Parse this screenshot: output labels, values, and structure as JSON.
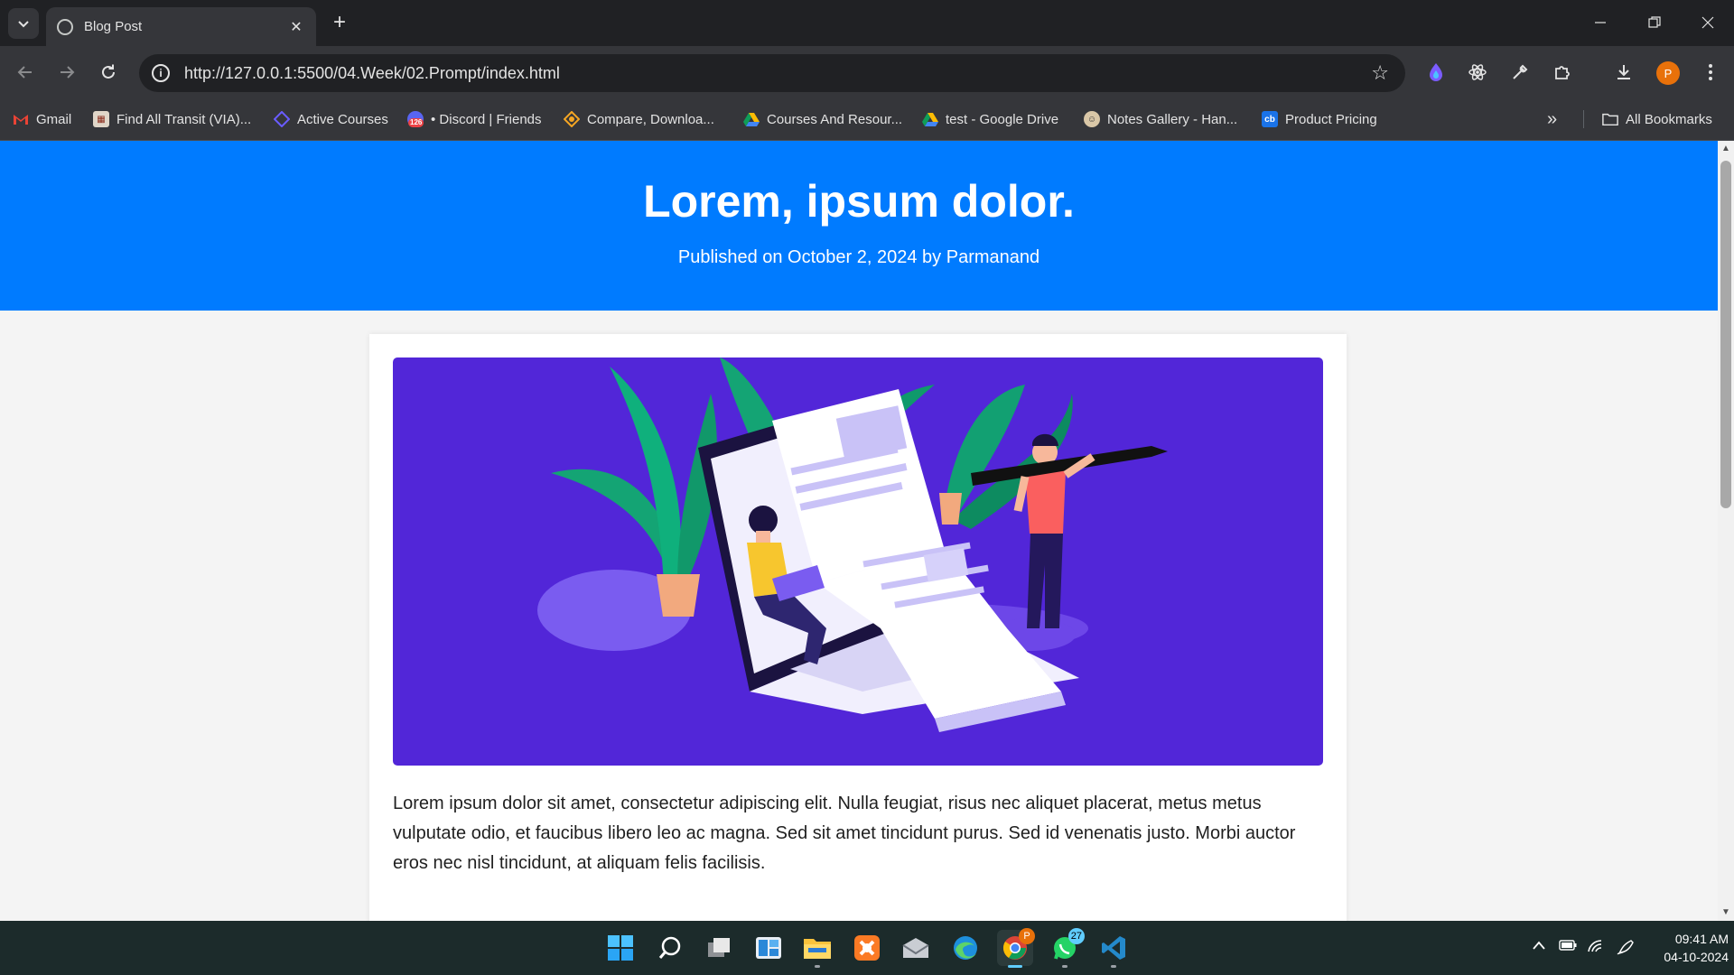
{
  "browser": {
    "tab_title": "Blog Post",
    "new_tab": "+",
    "close_tab": "✕",
    "url": "http://127.0.0.1:5500/04.Week/02.Prompt/index.html",
    "profile_initial": "P"
  },
  "bookmarks": {
    "items": [
      {
        "label": "Gmail",
        "icon": "gmail-icon"
      },
      {
        "label": "Find All Transit (VIA)...",
        "icon": "transit-icon"
      },
      {
        "label": "Active Courses",
        "icon": "courses-icon"
      },
      {
        "label": "• Discord | Friends",
        "icon": "discord-icon",
        "badge": "126"
      },
      {
        "label": "Compare, Downloa...",
        "icon": "compare-icon"
      },
      {
        "label": "Courses And Resour...",
        "icon": "google-drive-icon"
      },
      {
        "label": "test - Google Drive",
        "icon": "google-drive-icon"
      },
      {
        "label": "Notes Gallery - Han...",
        "icon": "notes-icon"
      },
      {
        "label": "Product Pricing",
        "icon": "pricing-icon",
        "badge": "cb"
      }
    ],
    "overflow": "»",
    "all_bookmarks": "All Bookmarks"
  },
  "page": {
    "title": "Lorem, ipsum dolor.",
    "meta": "Published on October 2, 2024 by Parmanand",
    "body": "Lorem ipsum dolor sit amet, consectetur adipiscing elit. Nulla feugiat, risus nec aliquet placerat, metus metus vulputate odio, et faucibus libero leo ac magna. Sed sit amet tincidunt purus. Sed id venenatis justo. Morbi auctor eros nec nisl tincidunt, at aliquam felis facilisis.",
    "hero_bg": "#5226d8",
    "header_bg": "#007bff"
  },
  "taskbar": {
    "whatsapp_badge": "27",
    "chrome_badge": "P",
    "time": "09:41 AM",
    "date": "04-10-2024"
  }
}
